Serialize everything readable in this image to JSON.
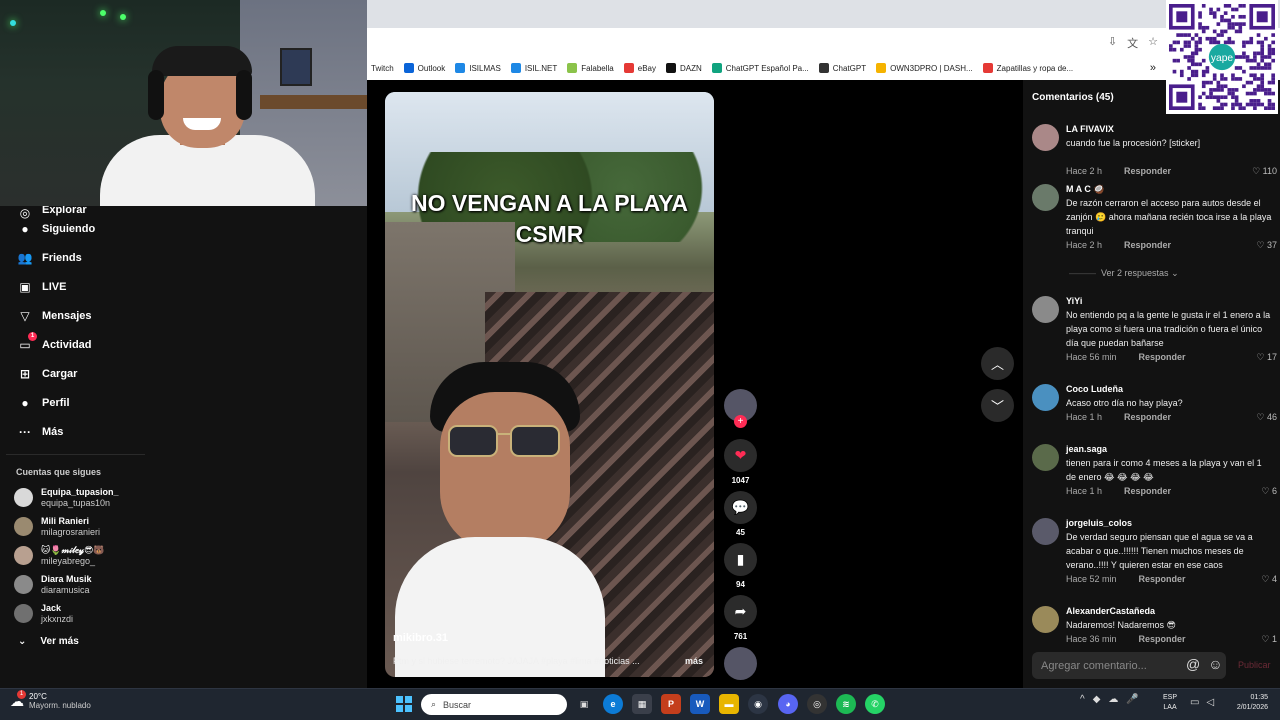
{
  "bookmarks": [
    {
      "label": "Twitch",
      "color": "#9146ff"
    },
    {
      "label": "Outlook",
      "color": "#0a64d8"
    },
    {
      "label": "ISILMAS",
      "color": "#1e88e5"
    },
    {
      "label": "ISIL.NET",
      "color": "#1e88e5"
    },
    {
      "label": "Falabella",
      "color": "#8bc34a"
    },
    {
      "label": "eBay",
      "color": "#e53935"
    },
    {
      "label": "DAZN",
      "color": "#111111"
    },
    {
      "label": "ChatGPT Español Pa...",
      "color": "#10a37f"
    },
    {
      "label": "ChatGPT",
      "color": "#333333"
    },
    {
      "label": "OWN3DPRO | DASH...",
      "color": "#f5b300"
    },
    {
      "label": "Zapatillas y ropa de...",
      "color": "#e53935"
    }
  ],
  "bookmarks_more": "»",
  "qr_caption": "yape",
  "sidebar": {
    "nav": [
      {
        "label": "Explorar",
        "icon": "compass-icon",
        "glyph": "◎"
      },
      {
        "label": "Siguiendo",
        "icon": "following-avatar-icon",
        "glyph": "●"
      },
      {
        "label": "Friends",
        "icon": "friends-icon",
        "glyph": "👥"
      },
      {
        "label": "LIVE",
        "icon": "live-icon",
        "glyph": "▣"
      },
      {
        "label": "Mensajes",
        "icon": "messages-icon",
        "glyph": "▽"
      },
      {
        "label": "Actividad",
        "icon": "activity-icon",
        "glyph": "▭",
        "badge": "1"
      },
      {
        "label": "Cargar",
        "icon": "upload-icon",
        "glyph": "⊞"
      },
      {
        "label": "Perfil",
        "icon": "profile-icon",
        "glyph": "●"
      },
      {
        "label": "Más",
        "icon": "more-icon",
        "glyph": "···"
      }
    ],
    "following_title": "Cuentas que sigues",
    "accounts": [
      {
        "name": "Equipa_tupasion_",
        "handle": "equipa_tupas10n",
        "color": "#d9d9d9"
      },
      {
        "name": "Mili Ranieri",
        "handle": "milagrosranieri",
        "color": "#9a8a70"
      },
      {
        "name": "🐱🌷𝓂𝒾𝓁𝑒𝓎😎🐻",
        "handle": "mileyabrego_",
        "color": "#b8a090"
      },
      {
        "name": "Diara Musik",
        "handle": "diaramusica",
        "color": "#8a8a8a"
      },
      {
        "name": "Jack",
        "handle": "jxkxnzdi",
        "color": "#707070"
      }
    ],
    "see_more": "Ver más"
  },
  "video": {
    "caption_line1": "NO VENGAN A LA PLAYA",
    "caption_line2": "CSMR",
    "author": "mikibro.31",
    "description": "Ptm y si hubiese terremoto? JAJAJA #playa #lima #noticias ...",
    "more": "más"
  },
  "actions": {
    "likes": "1047",
    "comments": "45",
    "saves": "94",
    "shares": "761"
  },
  "comments": {
    "header": "Comentarios (45)",
    "reply_label": "Responder",
    "view_replies": "Ver 2 respuestas",
    "items": [
      {
        "user": "LA FIVAVIX",
        "text": "cuando fue la procesión? [sticker]",
        "time": "Hace 2 h",
        "likes": "110",
        "color": "#a88"
      },
      {
        "user": "M A C 🥥",
        "text": "De razón cerraron el acceso para autos desde el zanjón 🥲 ahora mañana recién toca irse a la playa tranqui",
        "time": "Hace 2 h",
        "likes": "37",
        "color": "#6a7a6a"
      },
      {
        "user": "YiYi",
        "text": "No entiendo pq a la gente le gusta ir el 1 enero a la playa como si fuera una tradición o fuera el único día que puedan bañarse",
        "time": "Hace 56 min",
        "likes": "17",
        "color": "#8a8a8a"
      },
      {
        "user": "Coco Ludeña",
        "text": "Acaso otro día no hay playa?",
        "time": "Hace 1 h",
        "likes": "46",
        "color": "#4a90c0"
      },
      {
        "user": "jean.saga",
        "text": "tienen para ir como 4 meses a la playa y van el 1 de enero 😂 😂 😂 😂",
        "time": "Hace 1 h",
        "likes": "6",
        "color": "#5a6a4a"
      },
      {
        "user": "jorgeluis_colos",
        "text": "De verdad seguro piensan que el agua se va a acabar o que..!!!!!! Tienen muchos meses de verano..!!!! Y quieren estar en ese caos",
        "time": "Hace 52 min",
        "likes": "4",
        "color": "#5a5a6a"
      },
      {
        "user": "AlexanderCastañeda",
        "text": "Nadaremos! Nadaremos 😎",
        "time": "Hace 36 min",
        "likes": "1",
        "color": "#9a8a5a"
      }
    ],
    "input_placeholder": "Agregar comentario...",
    "publish": "Publicar"
  },
  "taskbar": {
    "temperature": "20°C",
    "weather": "Mayorm. nublado",
    "weather_badge": "1",
    "search_placeholder": "Buscar",
    "lang1": "ESP",
    "lang2": "LAA",
    "time": "01:35",
    "date": "2/01/2026"
  }
}
